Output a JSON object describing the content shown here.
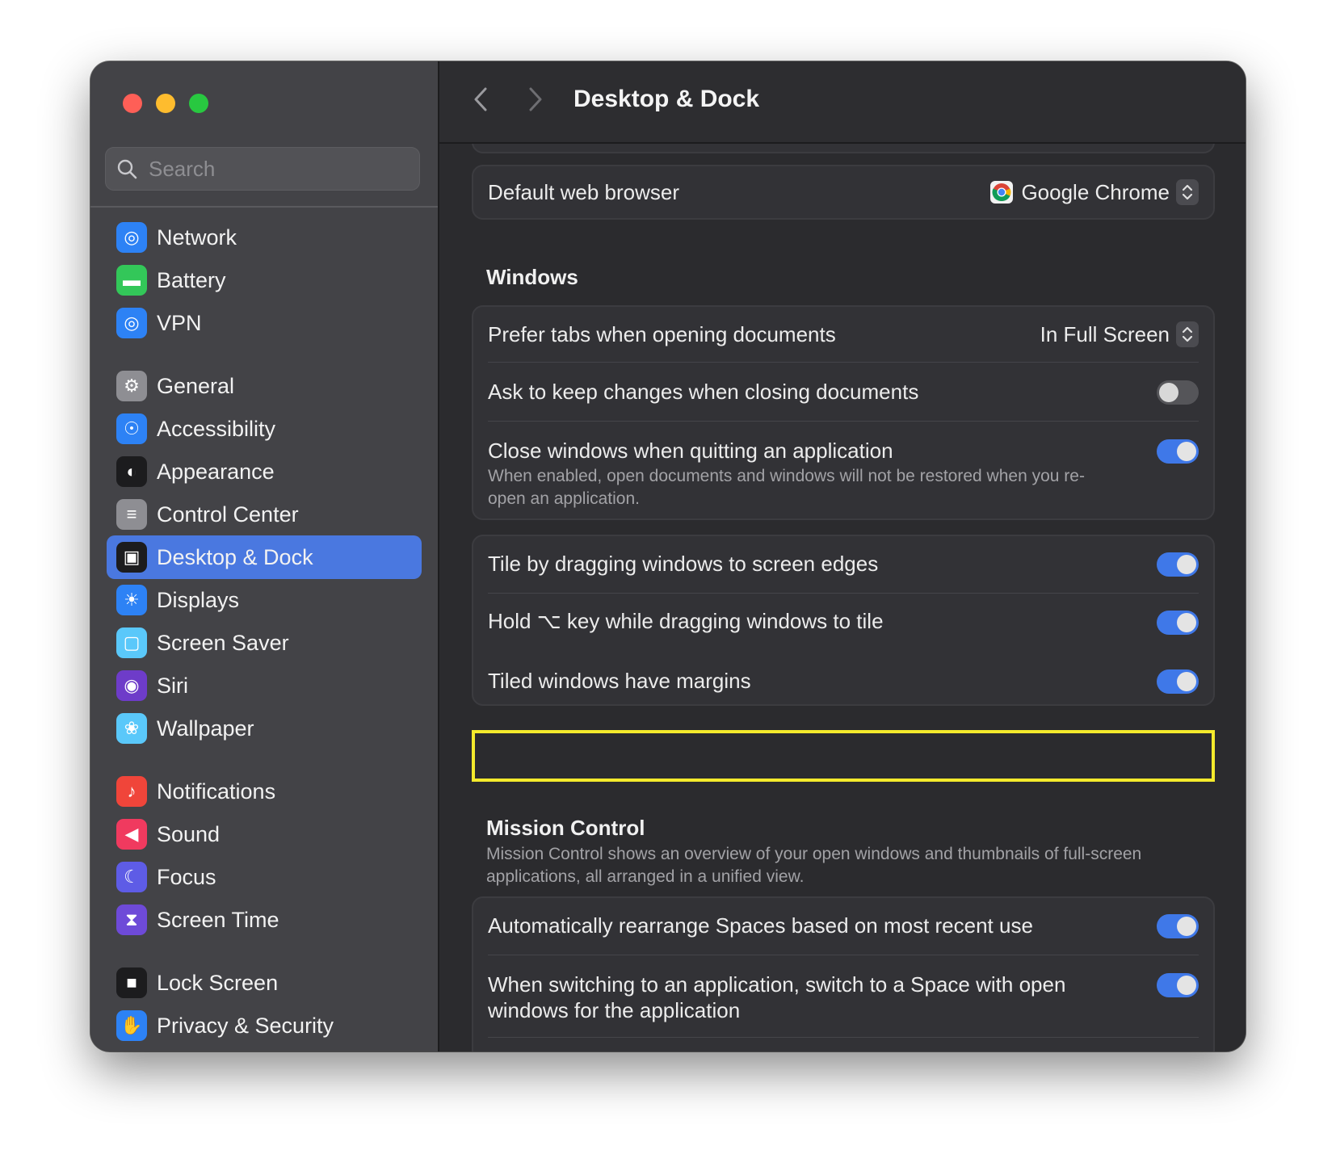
{
  "window": {
    "title": "Desktop & Dock"
  },
  "search": {
    "placeholder": "Search"
  },
  "sidebar": {
    "items": [
      {
        "label": "Network",
        "icon": "globe-icon",
        "color": "#2d82f5"
      },
      {
        "label": "Battery",
        "icon": "battery-icon",
        "color": "#33c759"
      },
      {
        "label": "VPN",
        "icon": "vpn-globe-icon",
        "color": "#2d82f5"
      },
      {
        "label": "General",
        "icon": "gear-icon",
        "color": "#8e8e93"
      },
      {
        "label": "Accessibility",
        "icon": "accessibility-icon",
        "color": "#2d82f5"
      },
      {
        "label": "Appearance",
        "icon": "appearance-icon",
        "color": "#1c1c1e"
      },
      {
        "label": "Control Center",
        "icon": "control-center-icon",
        "color": "#8e8e93"
      },
      {
        "label": "Desktop & Dock",
        "icon": "dock-icon",
        "color": "#1c1c1e",
        "selected": true
      },
      {
        "label": "Displays",
        "icon": "sun-icon",
        "color": "#2d82f5"
      },
      {
        "label": "Screen Saver",
        "icon": "screen-saver-icon",
        "color": "#5ac8fa"
      },
      {
        "label": "Siri",
        "icon": "siri-icon",
        "color": "#6e3cc9"
      },
      {
        "label": "Wallpaper",
        "icon": "flower-icon",
        "color": "#5ac8fa"
      },
      {
        "label": "Notifications",
        "icon": "bell-icon",
        "color": "#f0453a"
      },
      {
        "label": "Sound",
        "icon": "speaker-icon",
        "color": "#f03a5f"
      },
      {
        "label": "Focus",
        "icon": "moon-icon",
        "color": "#5e5ce6"
      },
      {
        "label": "Screen Time",
        "icon": "hourglass-icon",
        "color": "#6e4ad8"
      },
      {
        "label": "Lock Screen",
        "icon": "lock-icon",
        "color": "#1c1c1e"
      },
      {
        "label": "Privacy & Security",
        "icon": "hand-icon",
        "color": "#2d82f5"
      }
    ]
  },
  "main": {
    "title": "Desktop & Dock",
    "default_browser": {
      "label": "Default web browser",
      "value": "Google Chrome",
      "icon": "chrome-icon"
    },
    "windows": {
      "title": "Windows",
      "prefer_tabs": {
        "label": "Prefer tabs when opening documents",
        "value": "In Full Screen"
      },
      "ask_keep_changes": {
        "label": "Ask to keep changes when closing documents",
        "on": false
      },
      "close_windows": {
        "label": "Close windows when quitting an application",
        "description": "When enabled, open documents and windows will not be restored when you re-open an application.",
        "on": true
      }
    },
    "tiling": {
      "tile_drag": {
        "label": "Tile by dragging windows to screen edges",
        "on": true
      },
      "hold_option": {
        "label": "Hold ⌥ key while dragging windows to tile",
        "on": true
      },
      "tiled_margins": {
        "label": "Tiled windows have margins",
        "on": true
      }
    },
    "mission_control": {
      "title": "Mission Control",
      "description": "Mission Control shows an overview of your open windows and thumbnails of full-screen applications, all arranged in a unified view.",
      "auto_rearrange": {
        "label": "Automatically rearrange Spaces based on most recent use",
        "on": true
      },
      "switch_space": {
        "label": "When switching to an application, switch to a Space with open windows for the application",
        "on": true
      }
    }
  },
  "colors": {
    "accent": "#3f78e8",
    "highlight": "#f4ea2c",
    "selection": "#4a78e0"
  }
}
